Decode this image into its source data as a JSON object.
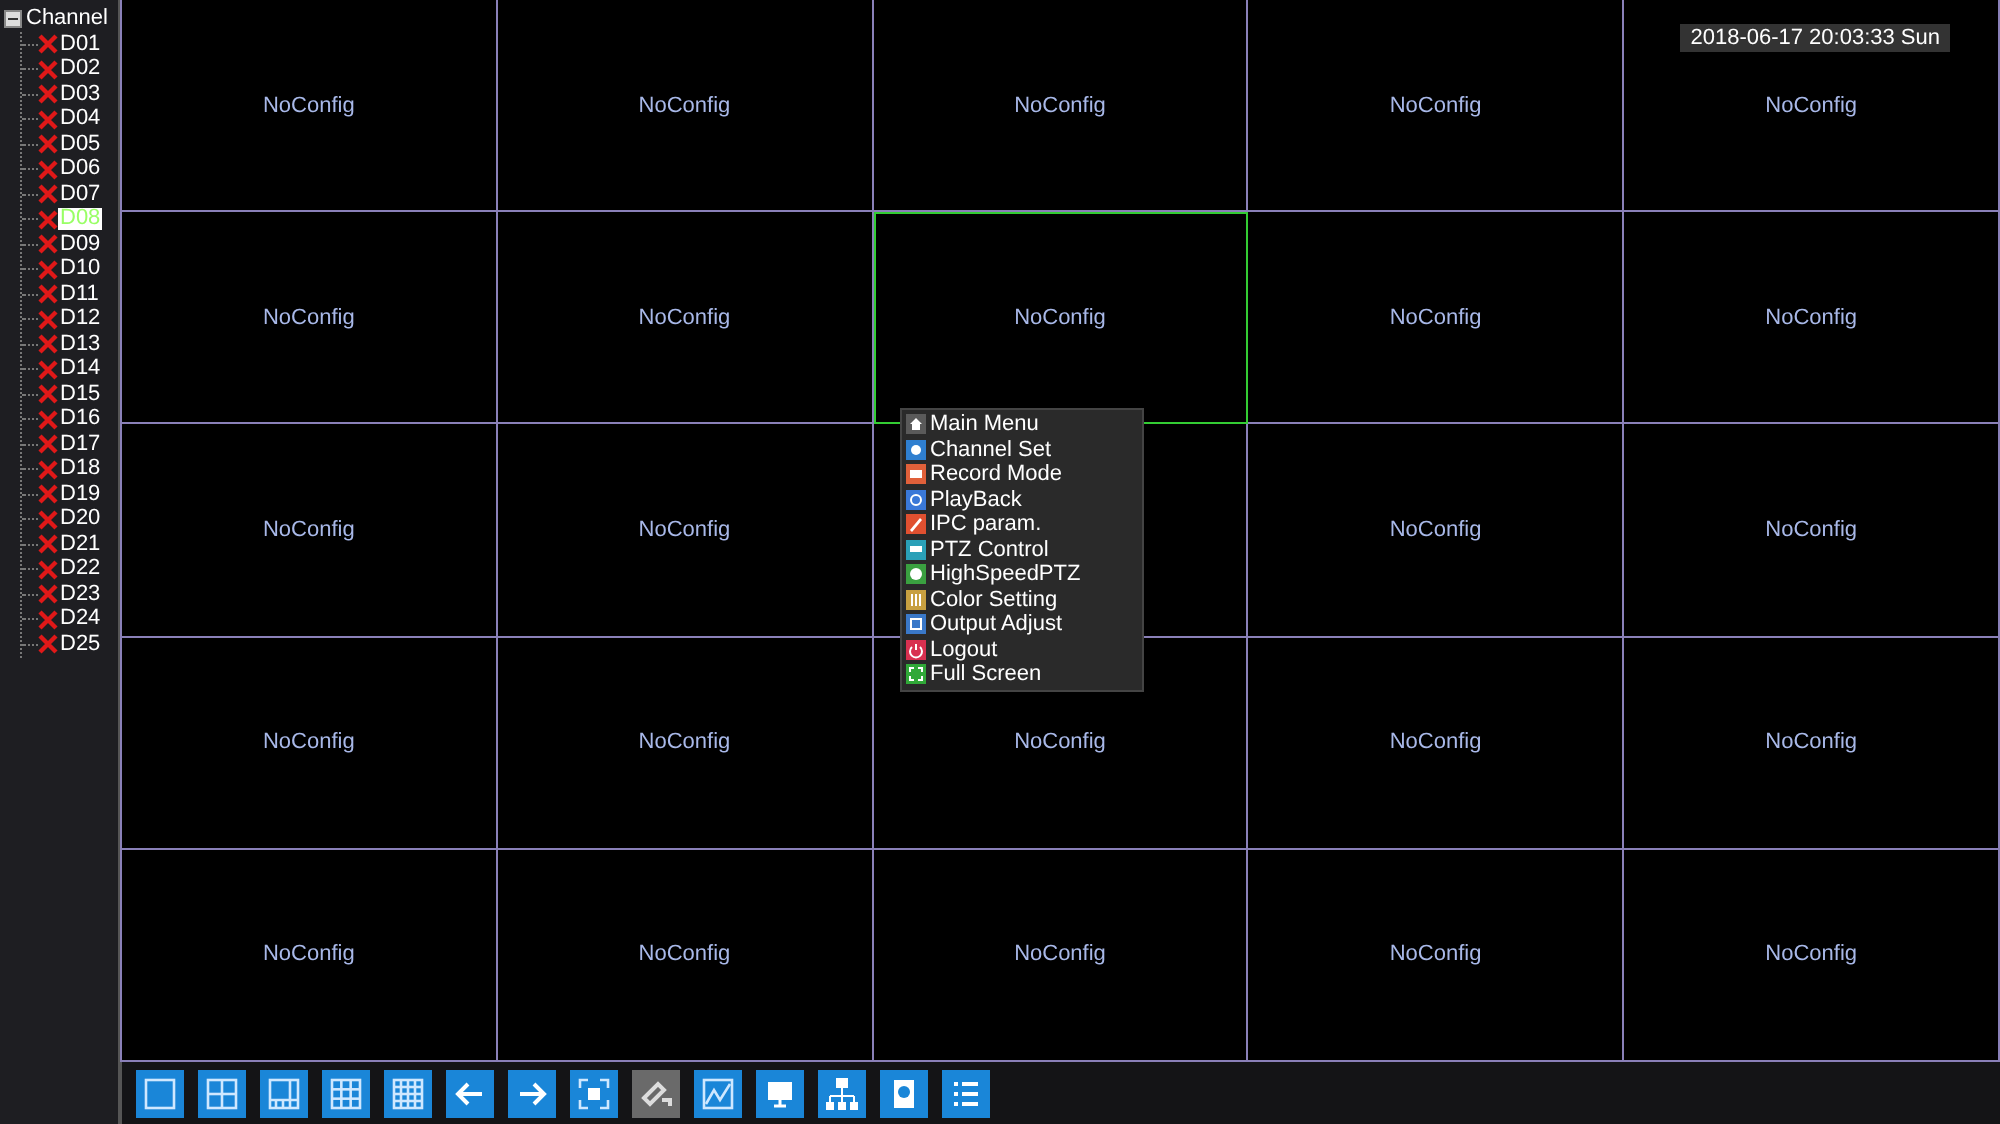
{
  "channel_tree": {
    "title": "Channel",
    "channels": [
      {
        "label": "D01",
        "selected": false
      },
      {
        "label": "D02",
        "selected": false
      },
      {
        "label": "D03",
        "selected": false
      },
      {
        "label": "D04",
        "selected": false
      },
      {
        "label": "D05",
        "selected": false
      },
      {
        "label": "D06",
        "selected": false
      },
      {
        "label": "D07",
        "selected": false
      },
      {
        "label": "D08",
        "selected": true
      },
      {
        "label": "D09",
        "selected": false
      },
      {
        "label": "D10",
        "selected": false
      },
      {
        "label": "D11",
        "selected": false
      },
      {
        "label": "D12",
        "selected": false
      },
      {
        "label": "D13",
        "selected": false
      },
      {
        "label": "D14",
        "selected": false
      },
      {
        "label": "D15",
        "selected": false
      },
      {
        "label": "D16",
        "selected": false
      },
      {
        "label": "D17",
        "selected": false
      },
      {
        "label": "D18",
        "selected": false
      },
      {
        "label": "D19",
        "selected": false
      },
      {
        "label": "D20",
        "selected": false
      },
      {
        "label": "D21",
        "selected": false
      },
      {
        "label": "D22",
        "selected": false
      },
      {
        "label": "D23",
        "selected": false
      },
      {
        "label": "D24",
        "selected": false
      },
      {
        "label": "D25",
        "selected": false
      }
    ]
  },
  "datetime": "2018-06-17 20:03:33 Sun",
  "video_cells": [
    {
      "label": "NoConfig",
      "selected": false
    },
    {
      "label": "NoConfig",
      "selected": false
    },
    {
      "label": "NoConfig",
      "selected": false
    },
    {
      "label": "NoConfig",
      "selected": false
    },
    {
      "label": "NoConfig",
      "selected": false
    },
    {
      "label": "NoConfig",
      "selected": false
    },
    {
      "label": "NoConfig",
      "selected": false
    },
    {
      "label": "NoConfig",
      "selected": true
    },
    {
      "label": "NoConfig",
      "selected": false
    },
    {
      "label": "NoConfig",
      "selected": false
    },
    {
      "label": "NoConfig",
      "selected": false
    },
    {
      "label": "NoConfig",
      "selected": false
    },
    {
      "selected": false
    },
    {
      "label": "NoConfig",
      "selected": false
    },
    {
      "label": "NoConfig",
      "selected": false
    },
    {
      "label": "NoConfig",
      "selected": false
    },
    {
      "label": "NoConfig",
      "selected": false
    },
    {
      "label": "NoConfig",
      "selected": false
    },
    {
      "label": "NoConfig",
      "selected": false
    },
    {
      "label": "NoConfig",
      "selected": false
    },
    {
      "label": "NoConfig",
      "selected": false
    },
    {
      "label": "NoConfig",
      "selected": false
    },
    {
      "label": "NoConfig",
      "selected": false
    },
    {
      "label": "NoConfig",
      "selected": false
    },
    {
      "label": "NoConfig",
      "selected": false
    }
  ],
  "context_menu": [
    {
      "label": "Main Menu",
      "kind": "home",
      "color": "#5a5a5a"
    },
    {
      "label": "Channel Set",
      "kind": "channel",
      "color": "#2f7fd0"
    },
    {
      "label": "Record Mode",
      "kind": "record",
      "color": "#e0603a"
    },
    {
      "label": "PlayBack",
      "kind": "play",
      "color": "#3a78d8"
    },
    {
      "label": "IPC param.",
      "kind": "pen",
      "color": "#e05030"
    },
    {
      "label": "PTZ Control",
      "kind": "ptz",
      "color": "#2aa0b8"
    },
    {
      "label": "HighSpeedPTZ",
      "kind": "dome",
      "color": "#3aa040"
    },
    {
      "label": "Color Setting",
      "kind": "color",
      "color": "#c8a040"
    },
    {
      "label": "Output Adjust",
      "kind": "output",
      "color": "#3a78c8"
    },
    {
      "label": "Logout",
      "kind": "power",
      "color": "#d83050"
    },
    {
      "label": "Full Screen",
      "kind": "full",
      "color": "#30a838"
    }
  ],
  "toolbar": [
    {
      "kind": "split1",
      "disabled": false
    },
    {
      "kind": "split4",
      "disabled": false
    },
    {
      "kind": "split8",
      "disabled": false
    },
    {
      "kind": "split9",
      "disabled": false
    },
    {
      "kind": "split16",
      "disabled": false
    },
    {
      "kind": "prev",
      "disabled": false
    },
    {
      "kind": "next",
      "disabled": false
    },
    {
      "kind": "fullscreen",
      "disabled": false
    },
    {
      "kind": "ptz",
      "disabled": true
    },
    {
      "kind": "chart",
      "disabled": false
    },
    {
      "kind": "monitor",
      "disabled": false
    },
    {
      "kind": "network",
      "disabled": false
    },
    {
      "kind": "disk",
      "disabled": false
    },
    {
      "kind": "list",
      "disabled": false
    }
  ]
}
